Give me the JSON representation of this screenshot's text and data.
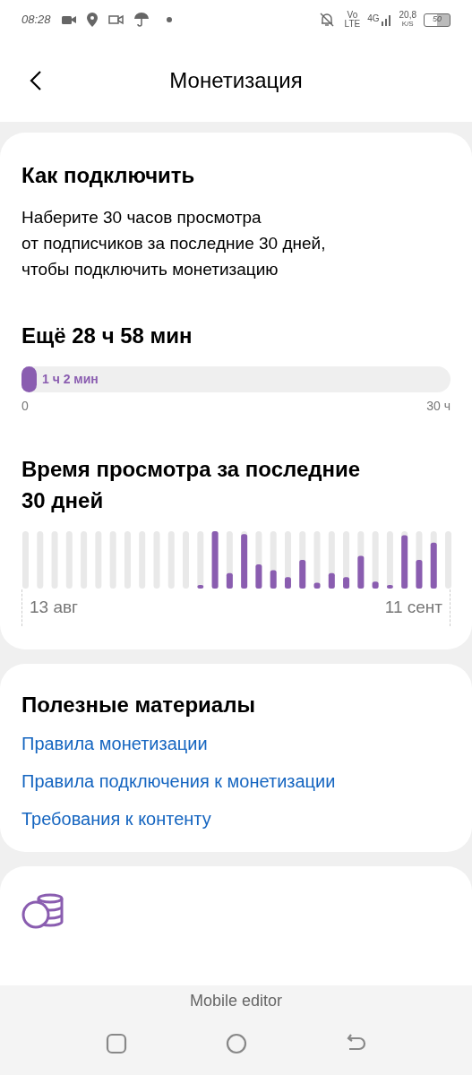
{
  "status_bar": {
    "time": "08:28",
    "network_top": "Vo",
    "network_bottom": "LTE",
    "signal_type": "4G",
    "speed_value": "20,8",
    "speed_unit": "K/S",
    "battery": "50"
  },
  "header": {
    "title": "Монетизация"
  },
  "connect_card": {
    "title": "Как подключить",
    "description": "Наберите 30 часов просмотра\nот подписчиков за последние 30 дней,\nчтобы подключить монетизацию",
    "remaining": "Ещё 28 ч 58 мин",
    "progress": {
      "level": 0.034,
      "label": "1 ч 2 мин",
      "min_label": "0",
      "max_label": "30 ч"
    },
    "chart": {
      "title": "Время просмотра за последние\n30 дней",
      "start_label": "13 авг",
      "end_label": "11 сент"
    }
  },
  "materials_card": {
    "title": "Полезные материалы",
    "links": [
      "Правила монетизации",
      "Правила подключения к монетизации",
      "Требования к контенту"
    ]
  },
  "nav_bar": {
    "app_label": "Mobile editor"
  }
}
